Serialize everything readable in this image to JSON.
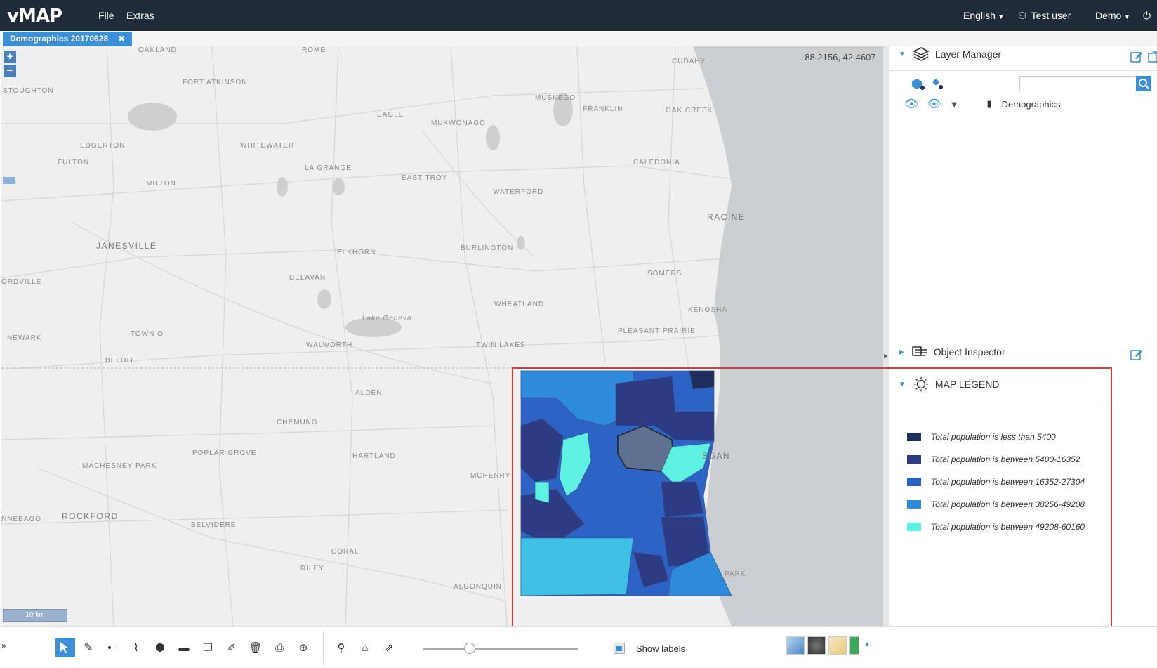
{
  "app": {
    "logo": "vMAP",
    "menu": [
      "File",
      "Extras"
    ],
    "language": "English",
    "user": "Test user",
    "profile": "Demo"
  },
  "tab": {
    "label": "Demographics 20170628",
    "close": "✖"
  },
  "map": {
    "coordinates": "-88.2156, 42.4607",
    "zoom_in": "+",
    "zoom_out": "−",
    "scale": "10 km",
    "places": [
      "OAKLAND",
      "ROME",
      "FORT ATKINSON",
      "CUDAHY",
      "STOUGHTON",
      "MUSKEGO",
      "FRANKLIN",
      "OAK CREEK",
      "EAGLE",
      "MUKWONAGO",
      "EDGERTON",
      "WHITEWATER",
      "FULTON",
      "LA GRANGE",
      "CALEDONIA",
      "MILTON",
      "EAST TROY",
      "WATERFORD",
      "RACINE",
      "JANESVILLE",
      "ELKHORN",
      "BURLINGTON",
      "SOMERS",
      "ORDVILLE",
      "DELAVAN",
      "WHEATLAND",
      "KENOSHA",
      "Lake Geneva",
      "PLEASANT PRAIRIE",
      "NEWARK",
      "TOWN O",
      "WALWORTH",
      "TWIN LAKES",
      "BELOIT",
      "ALDEN",
      "CHEMUNG",
      "POPLAR GROVE",
      "HARTLAND",
      "MACHESNEY PARK",
      "MCHENRY",
      "ROCKFORD",
      "NNEBAGO",
      "BELVIDERE",
      "CORAL",
      "RILEY",
      "ALGONQUIN",
      "EGAN",
      "PARK"
    ]
  },
  "layer_manager": {
    "title": "Layer Manager",
    "search_placeholder": "",
    "layers": [
      {
        "name": "Demographics"
      }
    ]
  },
  "object_inspector": {
    "title": "Object Inspector"
  },
  "legend": {
    "title": "MAP LEGEND",
    "items": [
      {
        "label": "Total population is less than 5400",
        "color": "#1f2f5c"
      },
      {
        "label": "Total population is between 5400-16352",
        "color": "#2b3c85"
      },
      {
        "label": "Total population is between 16352-27304",
        "color": "#2c63c4"
      },
      {
        "label": "Total population is between 38256-49208",
        "color": "#2e8bdc"
      },
      {
        "label": "Total population is between 49208-60160",
        "color": "#5ef0e0"
      }
    ]
  },
  "toolbar": {
    "show_labels": "Show labels",
    "tools": [
      "select-tool",
      "erase-tool",
      "point-tool",
      "line-tool",
      "polygon-tool",
      "measure-tool",
      "copy-tool",
      "edit-tool",
      "delete-tool",
      "print-tool",
      "zoom-extent-tool",
      "search-tool",
      "home-tool",
      "export-tool"
    ],
    "label_opacity": 0.3
  },
  "colors": {
    "topbar": "#1f2b38",
    "accent": "#3a8fd6",
    "highlight": "#d9393c"
  }
}
